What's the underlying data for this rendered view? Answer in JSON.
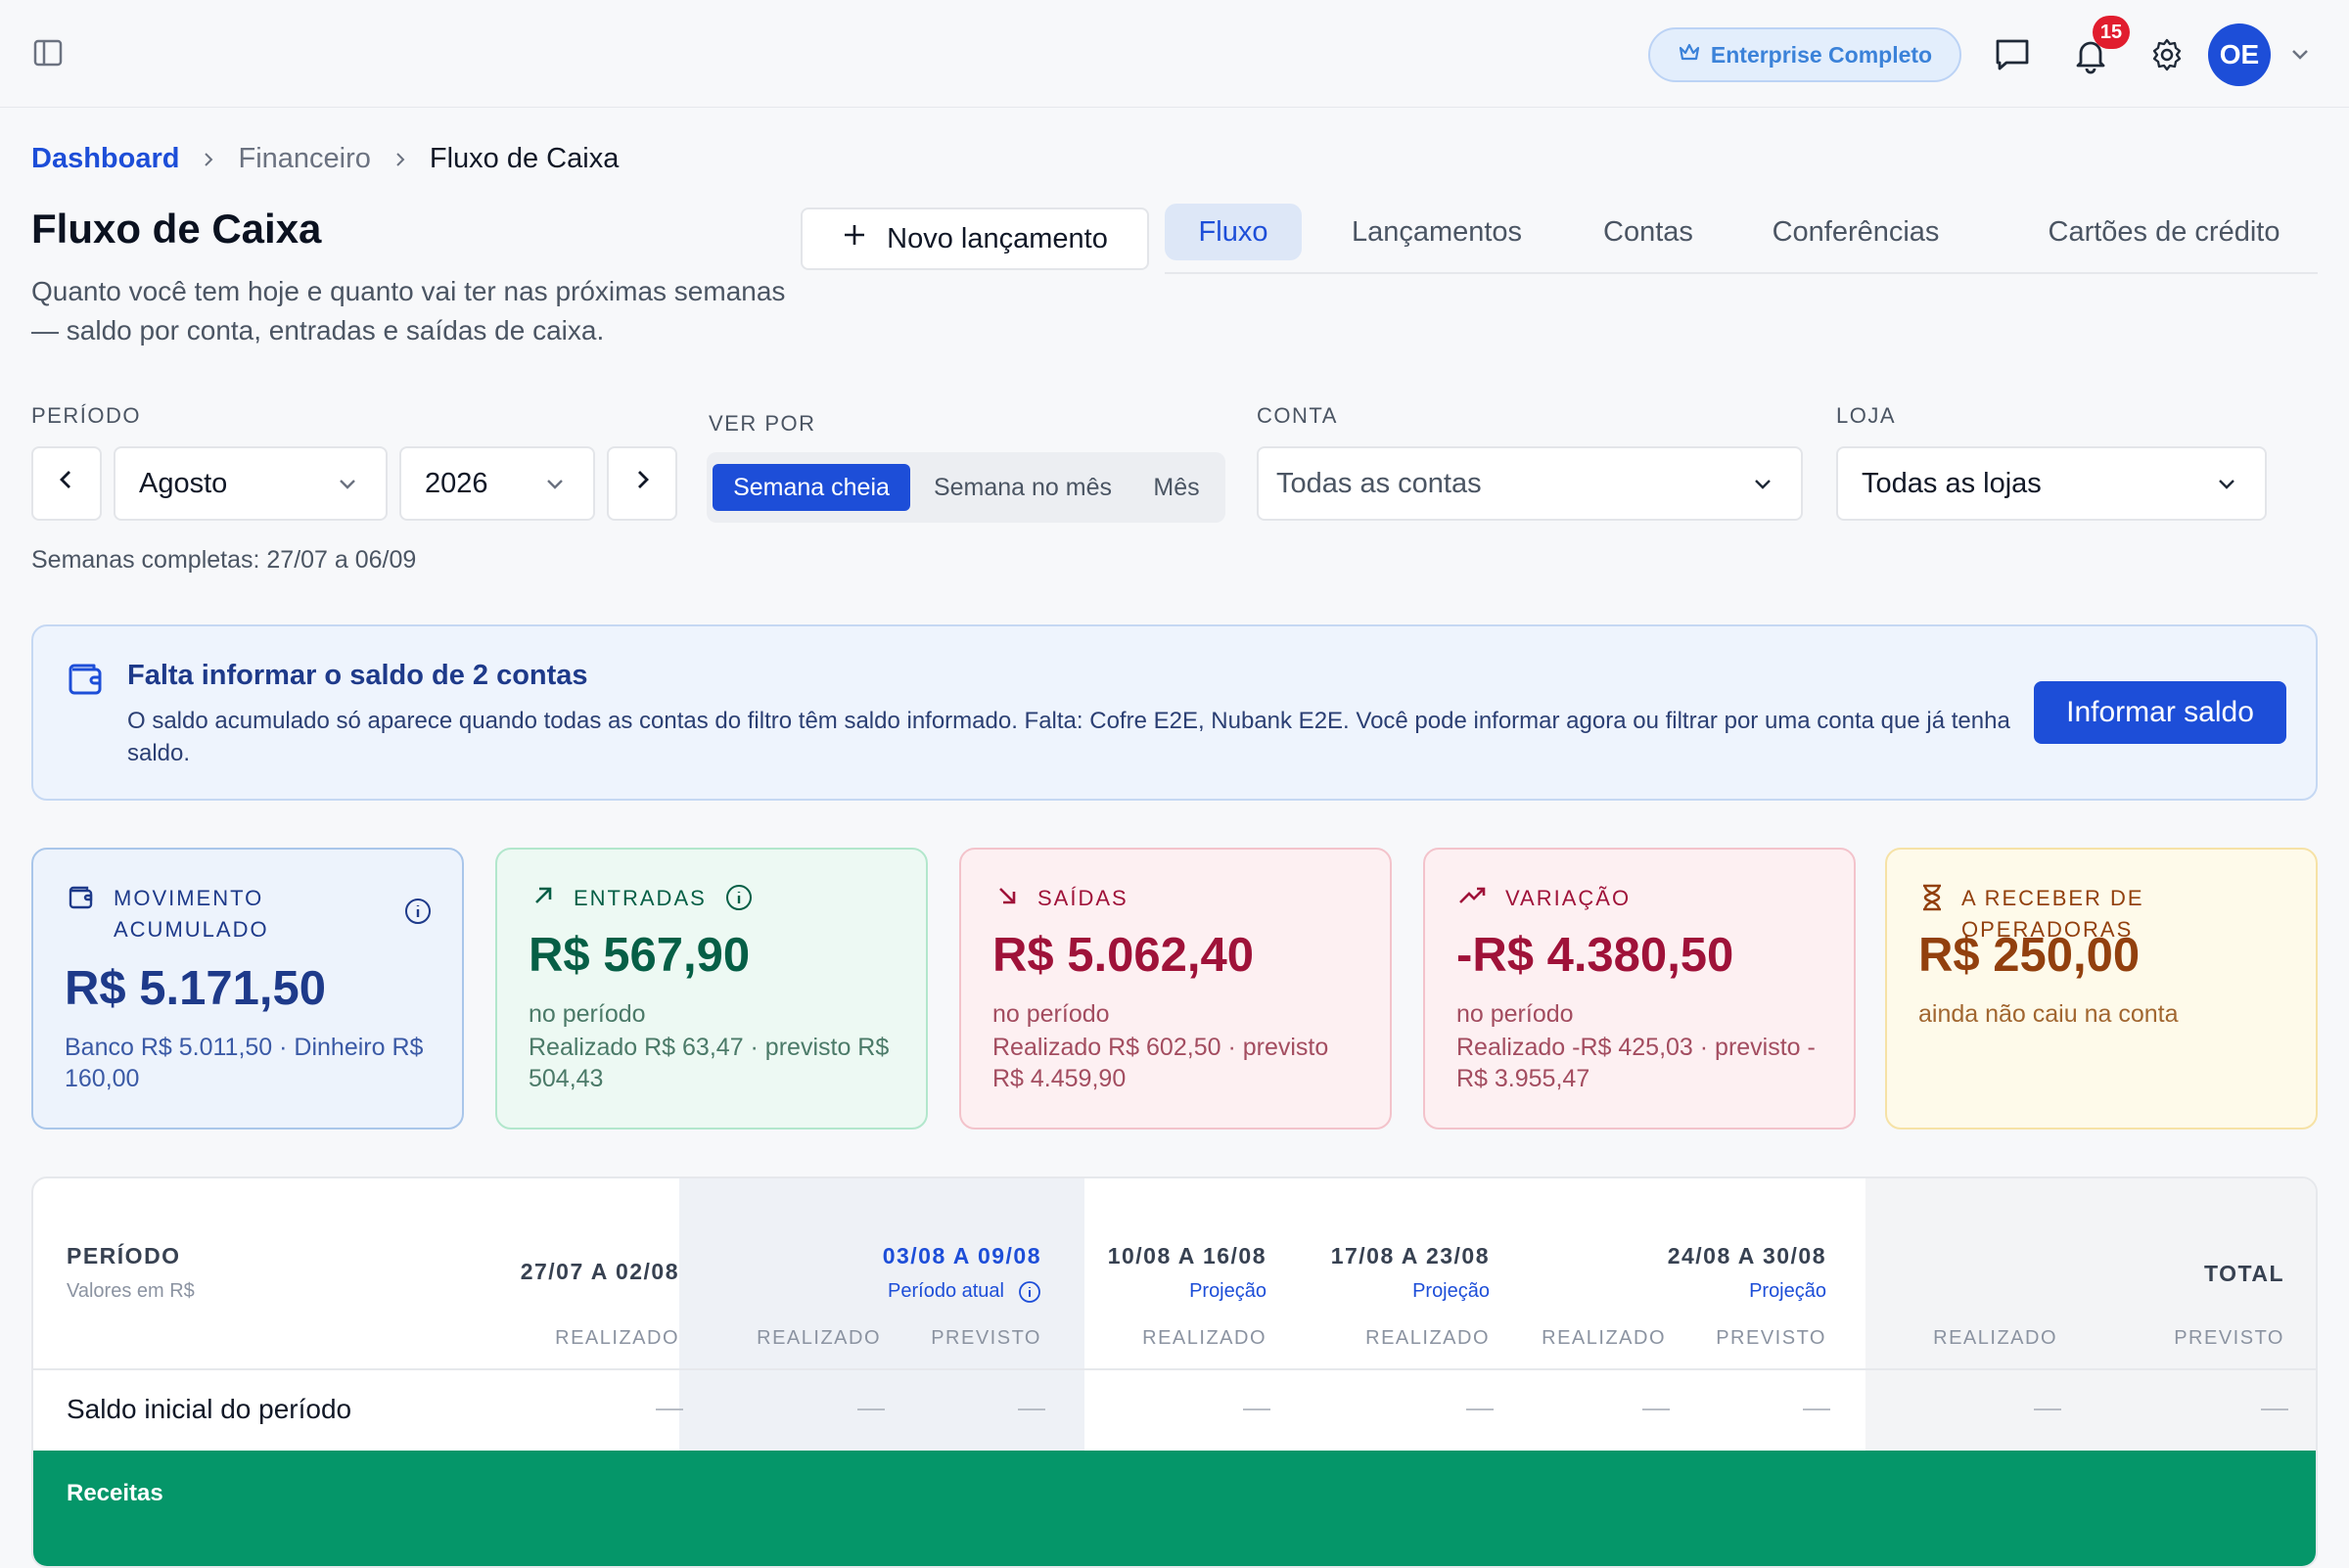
{
  "header": {
    "plan": "Enterprise Completo",
    "notifications_count": "15",
    "user_initials": "OE"
  },
  "breadcrumb": [
    "Dashboard",
    "Financeiro",
    "Fluxo de Caixa"
  ],
  "page": {
    "title": "Fluxo de Caixa",
    "subtitle": "Quanto você tem hoje e quanto vai ter nas próximas semanas — saldo por conta, entradas e saídas de caixa.",
    "new_button": "Novo lançamento"
  },
  "tabs": [
    "Fluxo",
    "Lançamentos",
    "Contas",
    "Conferências",
    "Cartões de crédito"
  ],
  "filters": {
    "period_label": "PERÍODO",
    "month": "Agosto",
    "year": "2026",
    "view_label": "VER POR",
    "view_options": [
      "Semana cheia",
      "Semana no mês",
      "Mês"
    ],
    "account_label": "CONTA",
    "account_value": "Todas as contas",
    "store_label": "LOJA",
    "store_value": "Todas as lojas",
    "weeks_note": "Semanas completas: 27/07 a 06/09"
  },
  "alert": {
    "title": "Falta informar o saldo de 2 contas",
    "text": "O saldo acumulado só aparece quando todas as contas do filtro têm saldo informado. Falta: Cofre E2E, Nubank E2E. Você pode informar agora ou filtrar por uma conta que já tenha saldo.",
    "button": "Informar saldo"
  },
  "kpis": [
    {
      "label": "MOVIMENTO ACUMULADO",
      "value": "R$ 5.171,50",
      "note": "Banco R$ 5.011,50 · Dinheiro R$ 160,00"
    },
    {
      "label": "ENTRADAS",
      "value": "R$ 567,90",
      "note1": "no período",
      "note2": "Realizado R$ 63,47 · previsto R$ 504,43"
    },
    {
      "label": "SAÍDAS",
      "value": "R$ 5.062,40",
      "note1": "no período",
      "note2": "Realizado R$ 602,50 · previsto R$ 4.459,90"
    },
    {
      "label": "VARIAÇÃO",
      "value": "-R$ 4.380,50",
      "note1": "no período",
      "note2": "Realizado -R$ 425,03 · previsto -R$ 3.955,47"
    },
    {
      "label": "A RECEBER DE OPERADORAS",
      "value": "R$ 250,00",
      "note1": "ainda não caiu na conta"
    }
  ],
  "table": {
    "period_header": "PERÍODO",
    "period_sub": "Valores em R$",
    "columns": [
      {
        "label": "27/07 A 02/08",
        "sub": ""
      },
      {
        "label": "03/08 A 09/08",
        "sub": "Período atual"
      },
      {
        "label": "10/08 A 16/08",
        "sub": "Projeção"
      },
      {
        "label": "17/08 A 23/08",
        "sub": "Projeção"
      },
      {
        "label": "24/08 A 30/08",
        "sub": "Projeção"
      },
      {
        "label": "TOTAL",
        "sub": ""
      }
    ],
    "realizado": "REALIZADO",
    "previsto": "PREVISTO",
    "row_label": "Saldo inicial do período",
    "empty": "—",
    "section": "Receitas"
  },
  "colors": {
    "accent": "#1d4ed8",
    "income": "#065f46",
    "expense": "#9f1239",
    "pending": "#92400e",
    "section": "#059669"
  }
}
